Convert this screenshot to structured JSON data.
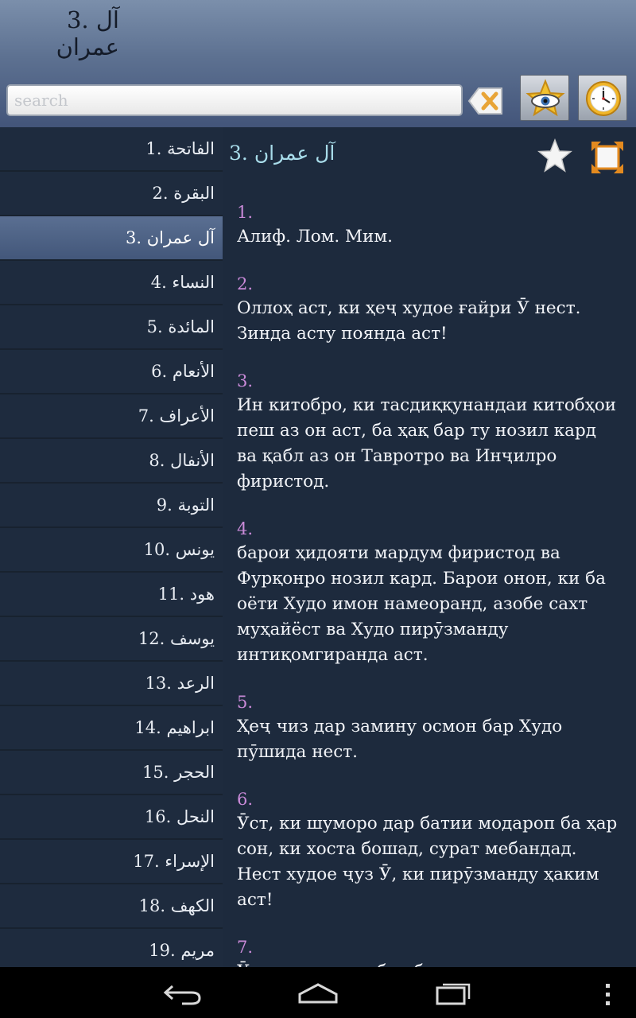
{
  "header": {
    "title_line1": "3. آل",
    "title_line2": "عمران"
  },
  "search": {
    "placeholder": "search",
    "value": ""
  },
  "toolbar": {
    "clear_icon": "clear-icon",
    "bookmark_view_icon": "star-eye-icon",
    "history_icon": "clock-icon"
  },
  "sidebar": {
    "items": [
      {
        "label": "1. الفاتحة",
        "selected": false
      },
      {
        "label": "2. البقرة",
        "selected": false
      },
      {
        "label": "3. آل عمران",
        "selected": true
      },
      {
        "label": "4. النساء",
        "selected": false
      },
      {
        "label": "5. المائدة",
        "selected": false
      },
      {
        "label": "6. الأنعام",
        "selected": false
      },
      {
        "label": "7. الأعراف",
        "selected": false
      },
      {
        "label": "8. الأنفال",
        "selected": false
      },
      {
        "label": "9. التوبة",
        "selected": false
      },
      {
        "label": "10. يونس",
        "selected": false
      },
      {
        "label": "11. هود",
        "selected": false
      },
      {
        "label": "12. يوسف",
        "selected": false
      },
      {
        "label": "13. الرعد",
        "selected": false
      },
      {
        "label": "14. ابراهيم",
        "selected": false
      },
      {
        "label": "15. الحجر",
        "selected": false
      },
      {
        "label": "16. النحل",
        "selected": false
      },
      {
        "label": "17. الإسراء",
        "selected": false
      },
      {
        "label": "18. الكهف",
        "selected": false
      },
      {
        "label": "19. مريم",
        "selected": false
      }
    ]
  },
  "main": {
    "title": "3. آل عمران",
    "verses": [
      {
        "num": "1.",
        "text": "Алиф. Лом. Мим."
      },
      {
        "num": "2.",
        "text": "Оллоҳ аст, ки ҳеҷ худое ғайри Ӯ нест. Зинда асту поянда аст!"
      },
      {
        "num": "3.",
        "text": "Ин китобро, ки тасдиққунандаи китобҳои пеш аз он аст, ба ҳақ бар ту нозил кард ва қабл аз он Тавротро ва Инҷилро фиристод."
      },
      {
        "num": "4.",
        "text": "барои ҳидояти мардум фиристод ва Фурқонро нозил кард. Барои онон, ки ба оёти Худо имон намеоранд, азобе сахт муҳайёст ва Худо пирӯзманду интиқомгиранда аст."
      },
      {
        "num": "5.",
        "text": "Ҳеҷ чиз дар замину осмон бар Худо пӯшида нест."
      },
      {
        "num": "6.",
        "text": "Ӯст, ки шуморо дар батии модароп ба ҳар сон, ки хоста бошад, сурат мебандад. Нест худое ҷуз Ӯ, ки пирӯзманду ҳаким аст!"
      },
      {
        "num": "7.",
        "text": "Ӯст, ки ин китобро бар ту нозил кард."
      }
    ]
  },
  "colors": {
    "background": "#1d2a3d",
    "verse_number": "#c98ad8",
    "title": "#a8dcea",
    "selected_item": "#4f6386"
  }
}
